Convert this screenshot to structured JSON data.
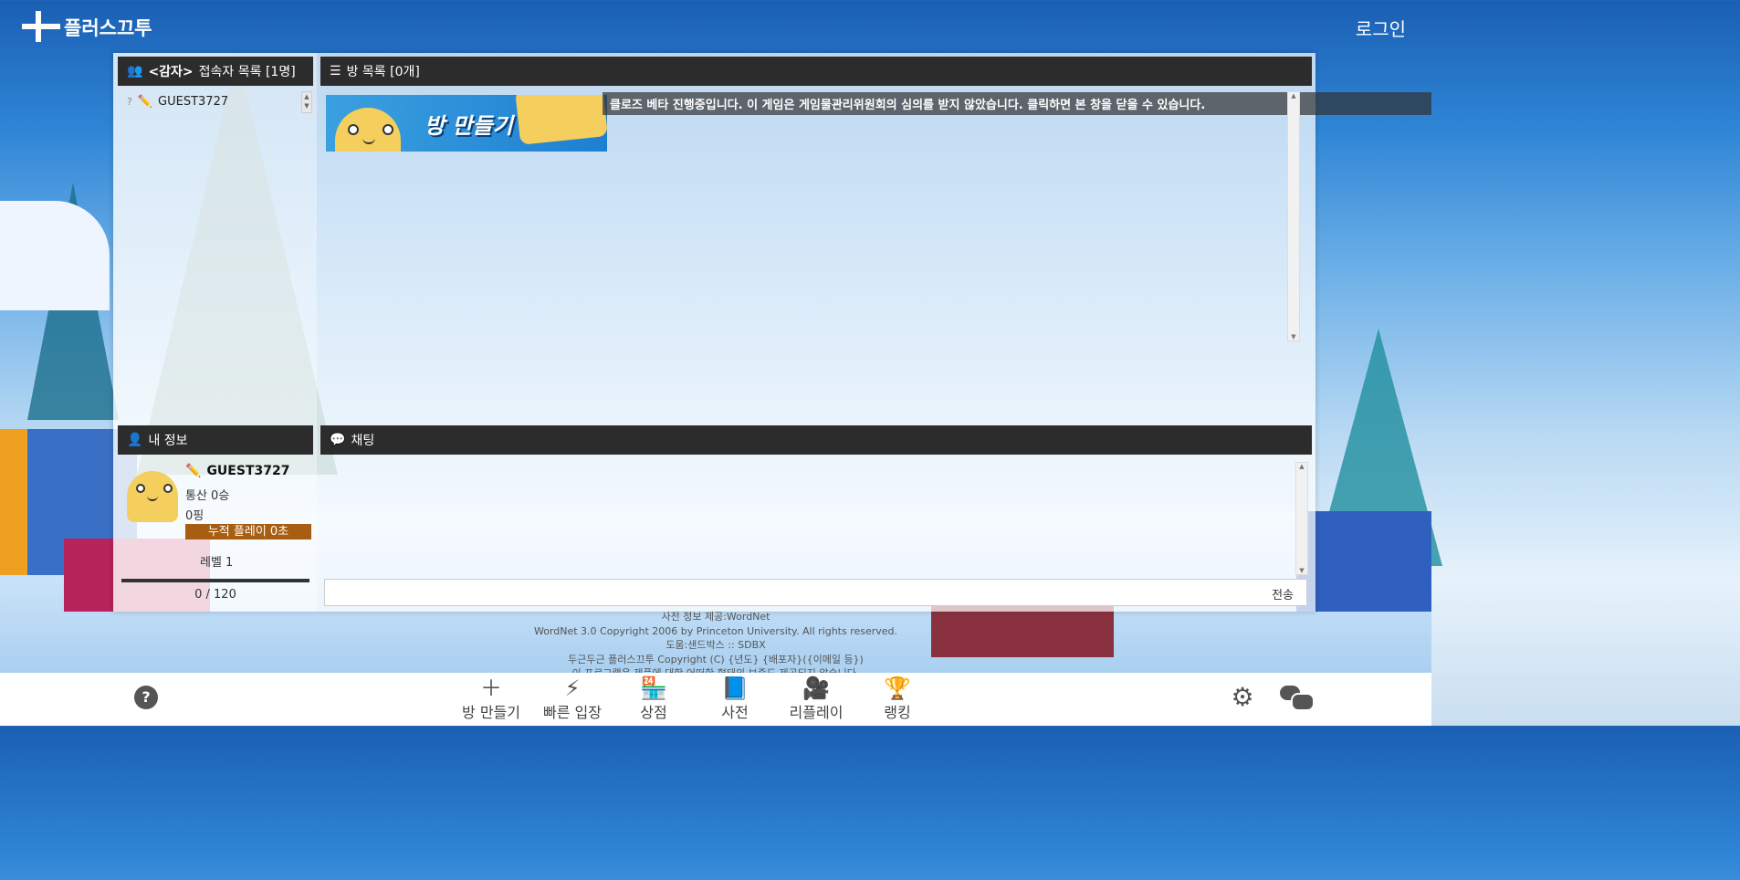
{
  "header": {
    "logo_text": "플러스끄투",
    "login_label": "로그인"
  },
  "users_panel": {
    "prefix": "<감자>",
    "title": "접속자 목록 [1명]",
    "users": [
      {
        "badge": "?",
        "name": "GUEST3727"
      }
    ]
  },
  "rooms_panel": {
    "title": "방 목록 [0개]",
    "create_room_label": "방 만들기"
  },
  "notice": "클로즈 베타 진행중입니다. 이 게임은 게임물관리위원회의 심의를 받지 않았습니다. 클릭하면 본 창을 닫을 수 있습니다.",
  "my_info": {
    "title": "내 정보",
    "name": "GUEST3727",
    "wins": "통산 0승",
    "ping": "0핑",
    "playtime": "누적 플레이 0초",
    "level": "레벨 1",
    "exp": "0 / 120",
    "exp_progress": 0
  },
  "chat": {
    "title": "채팅",
    "input_value": "",
    "send_label": "전송"
  },
  "footer": {
    "lines": [
      "사전 정보 제공:WordNet",
      "WordNet 3.0 Copyright 2006 by Princeton University. All rights reserved.",
      "도움:샌드박스 :: SDBX",
      "두근두근 플러스끄투 Copyright (C) {년도} {배포자}({이메일 등})",
      "이 프로그램은 제품에 대한 어떠한 형태의 보증도 제공되지 않습니다."
    ]
  },
  "bottom_nav": {
    "items": [
      {
        "label": "방 만들기",
        "icon": "plus-icon"
      },
      {
        "label": "빠른 입장",
        "icon": "bolt-icon"
      },
      {
        "label": "상점",
        "icon": "store-icon"
      },
      {
        "label": "사전",
        "icon": "book-icon"
      },
      {
        "label": "리플레이",
        "icon": "video-icon"
      },
      {
        "label": "랭킹",
        "icon": "trophy-icon"
      }
    ]
  },
  "colors": {
    "panel_header": "#2c2c2c",
    "playtime_bar": "#a85e12",
    "notice_bg": "rgba(50,50,50,0.7)"
  }
}
